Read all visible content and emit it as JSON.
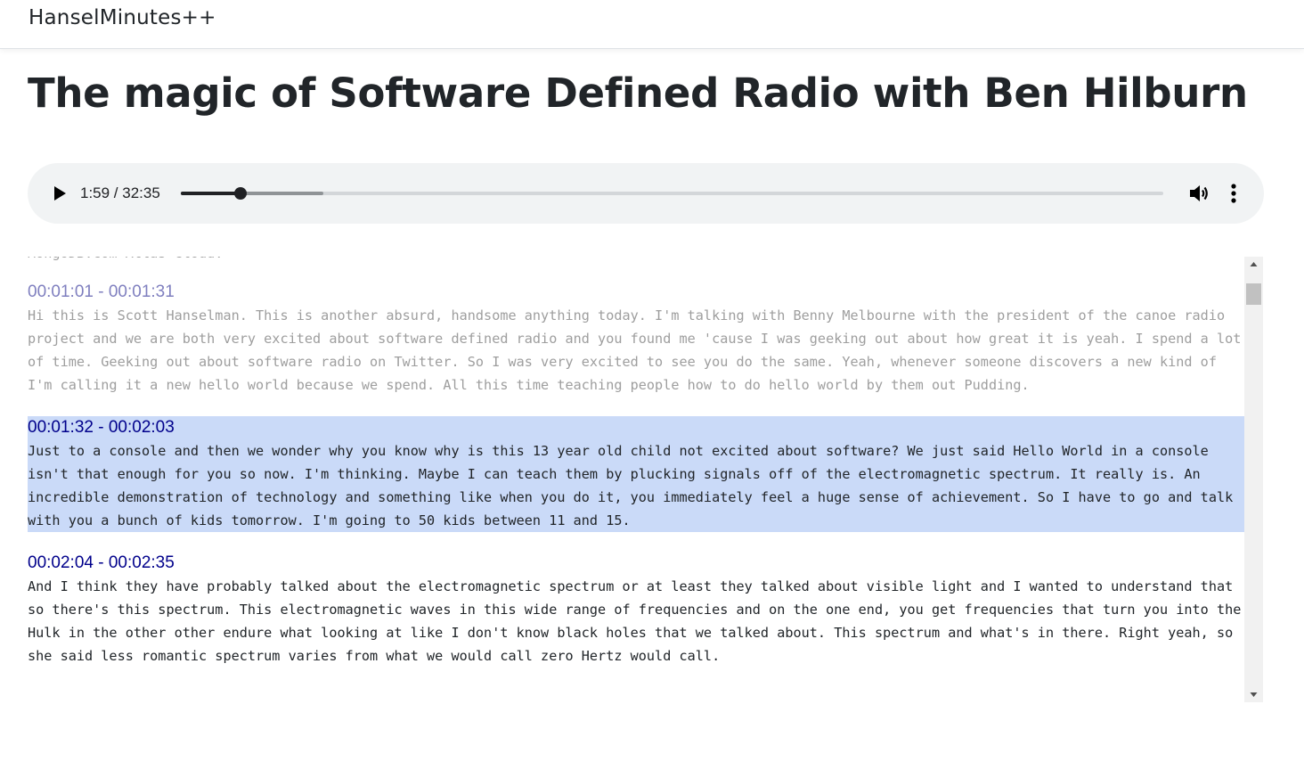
{
  "navbar": {
    "brand": "HanselMinutes++"
  },
  "episode": {
    "title": "The magic of Software Defined Radio with Ben Hilburn"
  },
  "player": {
    "time_display": "1:59 / 32:35",
    "progress_fraction": 0.0609,
    "buffered_fraction": 0.145,
    "icons": {
      "play": "play-icon",
      "volume": "volume-icon",
      "more": "more-vertical-icon"
    }
  },
  "transcript": {
    "clipped_text": "MongoDB.com Atlas Cloud.",
    "segments": [
      {
        "time": "00:01:01 - 00:01:31",
        "state": "past",
        "text": "Hi this is Scott Hanselman. This is another absurd, handsome anything today. I'm talking with Benny Melbourne with the president of the canoe radio project and we are both very excited about software defined radio and you found me 'cause I was geeking out about how great it is yeah. I spend a lot of time. Geeking out about software radio on Twitter. So I was very excited to see you do the same. Yeah, whenever someone discovers a new kind of I'm calling it a new hello world because we spend. All this time teaching people how to do hello world by them out Pudding."
      },
      {
        "time": "00:01:32 - 00:02:03",
        "state": "current",
        "text": "Just to a console and then we wonder why you know why is this 13 year old child not excited about software? We just said Hello World in a console isn't that enough for you so now. I'm thinking. Maybe I can teach them by plucking signals off of the electromagnetic spectrum. It really is. An incredible demonstration of technology and something like when you do it, you immediately feel a huge sense of achievement. So I have to go and talk with you a bunch of kids tomorrow. I'm going to 50 kids between 11 and 15."
      },
      {
        "time": "00:02:04 - 00:02:35",
        "state": "future",
        "text": "And I think they have probably talked about the electromagnetic spectrum or at least they talked about visible light and I wanted to understand that so there's this spectrum. This electromagnetic waves in this wide range of frequencies and on the one end, you get frequencies that turn you into the Hulk in the other other endure what looking at like I don't know black holes that we talked about. This spectrum and what's in there. Right yeah, so she said less romantic spectrum varies from what we would call zero Hertz would call."
      }
    ]
  },
  "colors": {
    "past_time": "#7f7fbf",
    "past_text": "#9e9e9e",
    "current_background": "#cadaf8",
    "active_time": "#00008b",
    "player_background": "#f1f3f4"
  },
  "scrollbar": {
    "up_icon": "triangle-up-icon",
    "down_icon": "triangle-down-icon"
  }
}
